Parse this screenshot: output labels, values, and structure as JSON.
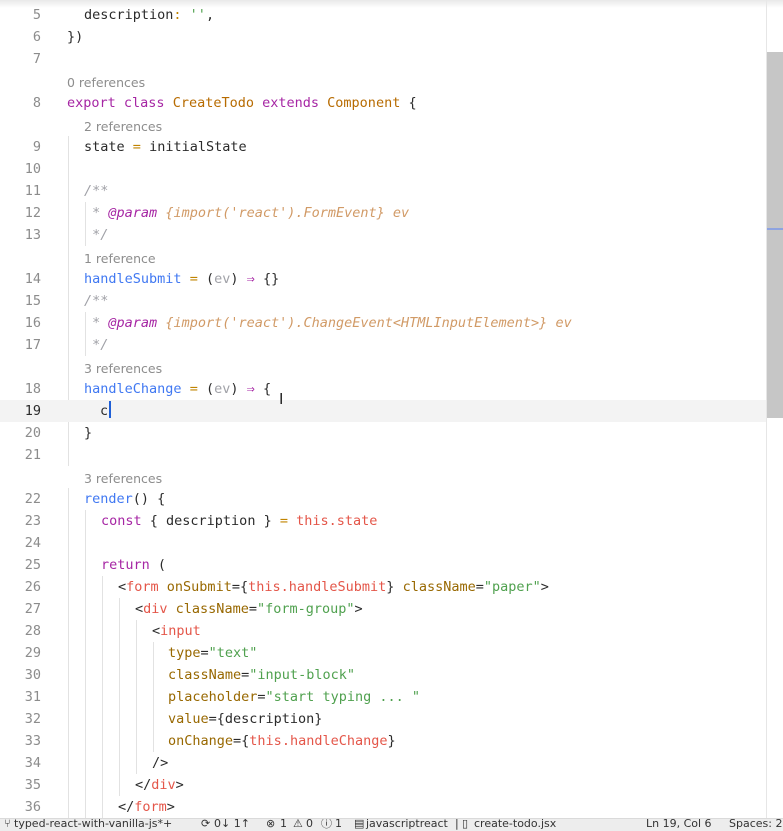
{
  "editor": {
    "lines": [
      {
        "n": "5"
      },
      {
        "n": "6"
      },
      {
        "n": "7"
      },
      {
        "n": "8"
      },
      {
        "n": "9"
      },
      {
        "n": "10"
      },
      {
        "n": "11"
      },
      {
        "n": "12"
      },
      {
        "n": "13"
      },
      {
        "n": "14"
      },
      {
        "n": "15"
      },
      {
        "n": "16"
      },
      {
        "n": "17"
      },
      {
        "n": "18"
      },
      {
        "n": "19"
      },
      {
        "n": "20"
      },
      {
        "n": "21"
      },
      {
        "n": "22"
      },
      {
        "n": "23"
      },
      {
        "n": "24"
      },
      {
        "n": "25"
      },
      {
        "n": "26"
      },
      {
        "n": "27"
      },
      {
        "n": "28"
      },
      {
        "n": "29"
      },
      {
        "n": "30"
      },
      {
        "n": "31"
      },
      {
        "n": "32"
      },
      {
        "n": "33"
      },
      {
        "n": "34"
      },
      {
        "n": "35"
      },
      {
        "n": "36"
      }
    ],
    "code_lens": {
      "class_refs": "0 references",
      "state_refs": "2 references",
      "submit_refs": "1 reference",
      "change_refs": "3 references",
      "render_refs": "3 references"
    },
    "code": {
      "l5_key": "description",
      "l5_colon": ": ",
      "l5_val": "''",
      "l5_end": ",",
      "l6": "})",
      "l8_export": "export",
      "l8_class_kw": "class",
      "l8_name": "CreateTodo",
      "l8_extends": "extends",
      "l8_parent": "Component",
      "l8_brace": "{",
      "l9_state": "state",
      "l9_eq": "=",
      "l9_val": "initialState",
      "l11": "/**",
      "l12_star": " * ",
      "l12_tag": "@param",
      "l12_type": "{import('react').FormEvent}",
      "l12_name": "ev",
      "l13": " */",
      "l14_name": "handleSubmit",
      "l14_eq": "=",
      "l14_open": "(",
      "l14_param": "ev",
      "l14_close": ")",
      "l14_arrow": "⇒",
      "l14_body": "{}",
      "l15": "/**",
      "l16_star": " * ",
      "l16_tag": "@param",
      "l16_type": "{import('react').ChangeEvent<HTMLInputElement>}",
      "l16_name": "ev",
      "l17": " */",
      "l18_name": "handleChange",
      "l18_eq": "=",
      "l18_open": "(",
      "l18_param": "ev",
      "l18_close": ")",
      "l18_arrow": "⇒",
      "l18_brace": "{",
      "l19_typed": "c",
      "l20": "}",
      "l22_name": "render",
      "l22_rest": "() {",
      "l23_const": "const",
      "l23_mid": "{ description }",
      "l23_eq": "=",
      "l23_this": "this",
      "l23_prop": ".state",
      "l25_return": "return",
      "l25_paren": "(",
      "l26_lt": "<",
      "l26_tag": "form",
      "l26_attr1": "onSubmit",
      "l26_eq1": "={",
      "l26_this": "this",
      "l26_prop": ".handleSubmit",
      "l26_close1": "}",
      "l26_attr2": "className",
      "l26_eq2": "=",
      "l26_str": "\"paper\"",
      "l26_gt": ">",
      "l27_lt": "<",
      "l27_tag": "div",
      "l27_attr": "className",
      "l27_eq": "=",
      "l27_str": "\"form-group\"",
      "l27_gt": ">",
      "l28_lt": "<",
      "l28_tag": "input",
      "l29_attr": "type",
      "l29_eq": "=",
      "l29_str": "\"text\"",
      "l30_attr": "className",
      "l30_eq": "=",
      "l30_str": "\"input-block\"",
      "l31_attr": "placeholder",
      "l31_eq": "=",
      "l31_str": "\"start typing ... \"",
      "l32_attr": "value",
      "l32_rest": "={description}",
      "l33_attr": "onChange",
      "l33_eq": "={",
      "l33_this": "this",
      "l33_prop": ".handleChange",
      "l33_close": "}",
      "l34": "/>",
      "l35_lt": "</",
      "l35_tag": "div",
      "l35_gt": ">",
      "l36_lt": "</",
      "l36_tag": "form",
      "l36_gt": ">"
    }
  },
  "cursor": {
    "line": "19",
    "col": "6",
    "icon": "i-beam"
  },
  "statusbar": {
    "branch_icon": "git-branch-icon",
    "branch": "typed-react-with-vanilla-js*+",
    "sync_icon": "sync-icon",
    "sync": "0↓ 1↑",
    "errors_icon": "error-icon",
    "errors": "1",
    "warnings_icon": "warning-icon",
    "warnings": "0",
    "info_icon": "info-icon",
    "info": "1",
    "language": "javascriptreact",
    "file_icon": "file-icon",
    "file": "create-todo.jsx",
    "position": "Ln 19, Col 6",
    "spaces": "Spaces: 2"
  },
  "colors": {
    "keyword": "#a626a4",
    "class_name": "#b76b01",
    "function": "#4078f2",
    "string": "#50a14f",
    "this": "#e45649",
    "comment": "#a0a1a7",
    "cursor": "#1f5fd6"
  }
}
